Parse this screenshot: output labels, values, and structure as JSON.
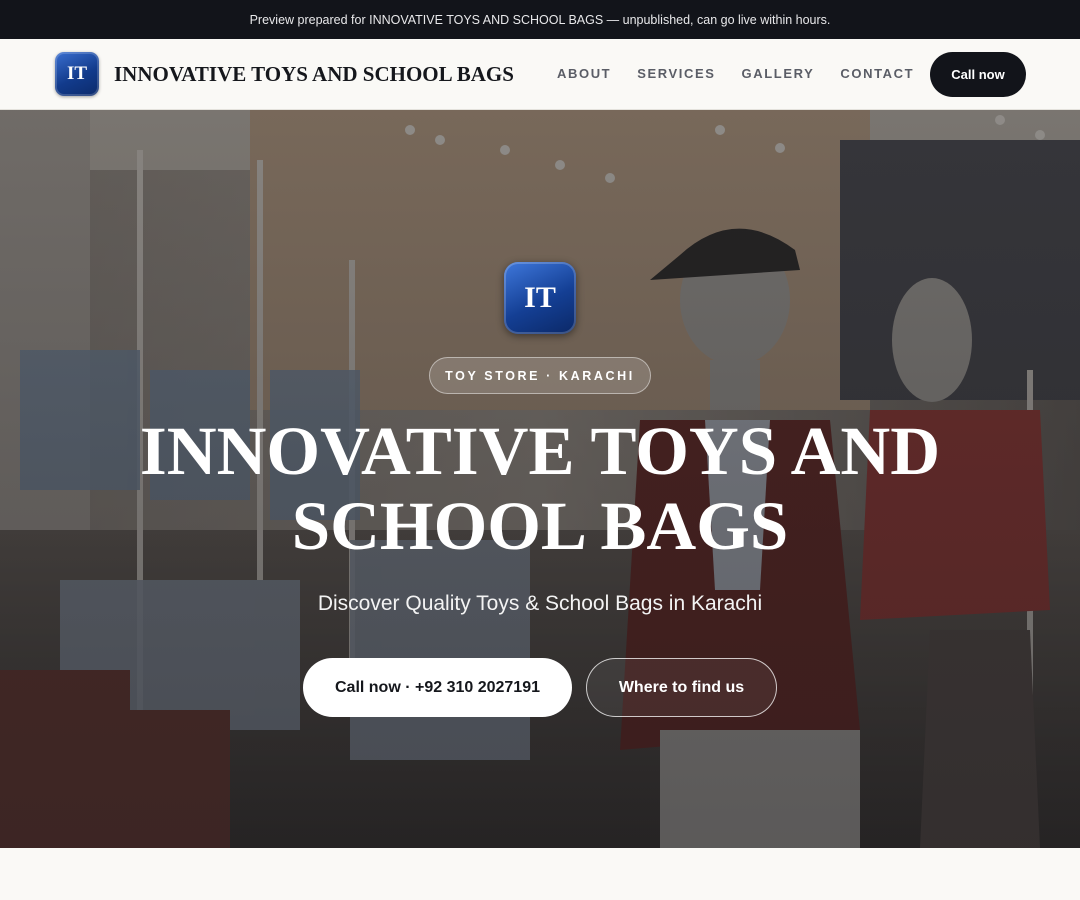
{
  "banner": {
    "text": "Preview prepared for INNOVATIVE TOYS AND SCHOOL BAGS — unpublished, can go live within hours."
  },
  "header": {
    "logo_initials": "IT",
    "brand_name": "INNOVATIVE TOYS AND SCHOOL BAGS",
    "nav": [
      {
        "label": "ABOUT"
      },
      {
        "label": "SERVICES"
      },
      {
        "label": "GALLERY"
      },
      {
        "label": "CONTACT"
      }
    ],
    "cta_label": "Call now"
  },
  "hero": {
    "logo_initials": "IT",
    "pill": "TOY STORE · KARACHI",
    "title": "INNOVATIVE TOYS AND SCHOOL BAGS",
    "subtitle": "Discover Quality Toys & School Bags in Karachi",
    "primary_cta": "Call now · +92 310 2027191",
    "secondary_cta": "Where to find us",
    "background": "clothing store interior with mannequins and clothing racks"
  },
  "colors": {
    "dark": "#12141a",
    "page_bg": "#faf9f6",
    "brand_blue": "#143f94",
    "white": "#ffffff"
  }
}
